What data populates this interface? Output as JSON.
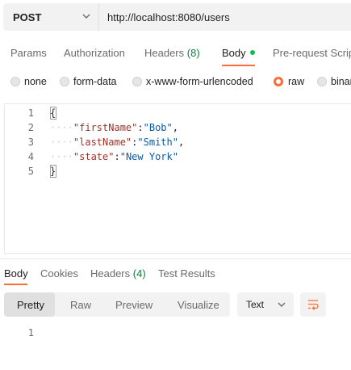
{
  "request": {
    "method": "POST",
    "url": "http://localhost:8080/users"
  },
  "tabs": [
    {
      "label": "Params"
    },
    {
      "label": "Authorization"
    },
    {
      "label": "Headers",
      "count": "(8)"
    },
    {
      "label": "Body",
      "active": true
    },
    {
      "label": "Pre-request Script"
    }
  ],
  "body_types": [
    {
      "label": "none",
      "selected": false
    },
    {
      "label": "form-data",
      "selected": false
    },
    {
      "label": "x-www-form-urlencoded",
      "selected": false
    },
    {
      "label": "raw",
      "selected": true
    },
    {
      "label": "binary",
      "selected": false
    }
  ],
  "editor": {
    "line_numbers": [
      "1",
      "2",
      "3",
      "4",
      "5"
    ],
    "lines": [
      {
        "open": "{"
      },
      {
        "indent": "····",
        "key": "\"firstName\"",
        "sep": ":",
        "value": "\"Bob\"",
        "end": ","
      },
      {
        "indent": "····",
        "key": "\"lastName\"",
        "sep": ":",
        "value": "\"Smith\"",
        "end": ","
      },
      {
        "indent": "····",
        "key": "\"state\"",
        "sep": ":",
        "value": "\"New York\"",
        "end": ""
      },
      {
        "close": "}"
      }
    ]
  },
  "response_tabs": [
    {
      "label": "Body",
      "active": true
    },
    {
      "label": "Cookies"
    },
    {
      "label": "Headers",
      "count": "(4)"
    },
    {
      "label": "Test Results"
    }
  ],
  "view_modes": [
    "Pretty",
    "Raw",
    "Preview",
    "Visualize"
  ],
  "format": "Text",
  "response_line_numbers": [
    "1"
  ],
  "colors": {
    "accent": "#ff6c37",
    "count_green": "#0c7f3f",
    "status_dot": "#0cbb52"
  },
  "icons": {
    "method_dropdown": "chevron-down-icon",
    "format_dropdown": "chevron-down-icon",
    "wrap": "wrap-lines-icon"
  }
}
